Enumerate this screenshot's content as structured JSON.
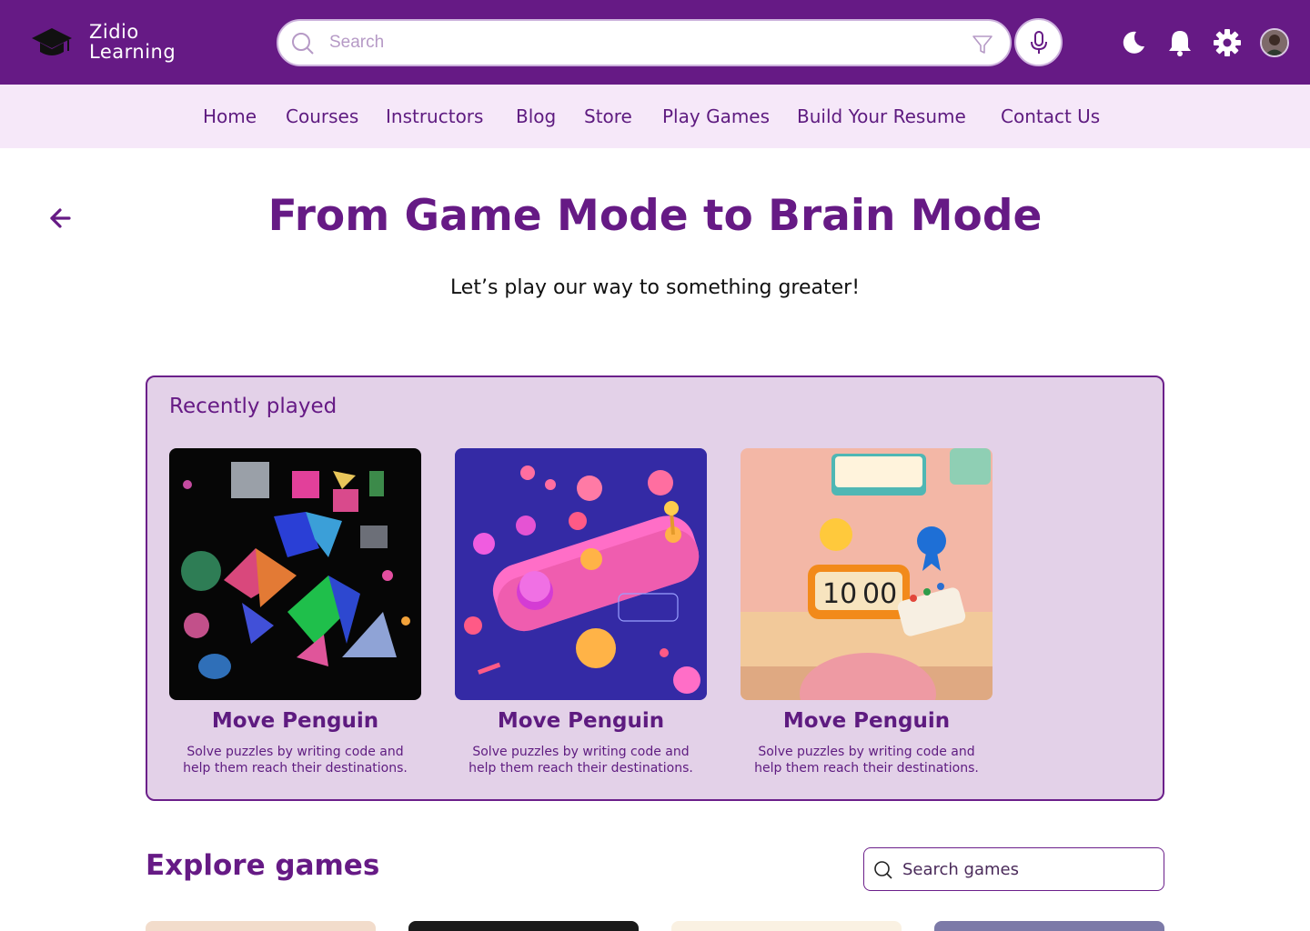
{
  "brand": {
    "line1": "Zidio",
    "line2": "Learning",
    "icon": "graduation-cap-icon"
  },
  "header": {
    "search_placeholder": "Search",
    "icons": [
      "search-icon",
      "filter-icon",
      "microphone-icon",
      "moon-icon",
      "bell-icon",
      "gear-icon",
      "avatar"
    ]
  },
  "nav": {
    "items": [
      {
        "label": "Home"
      },
      {
        "label": "Courses"
      },
      {
        "label": "Instructors"
      },
      {
        "label": "Blog"
      },
      {
        "label": "Store"
      },
      {
        "label": "Play Games"
      },
      {
        "label": "Build Your Resume"
      },
      {
        "label": "Contact Us"
      }
    ]
  },
  "hero": {
    "title": "From Game Mode to Brain Mode",
    "subtitle": "Let’s play our way to something greater!"
  },
  "recently_played": {
    "heading": "Recently played",
    "cards": [
      {
        "title": "Move Penguin",
        "desc1": "Solve puzzles by writing code and",
        "desc2": "help them reach their destinations.",
        "image": "colorful-shapes-on-black"
      },
      {
        "title": "Move Penguin",
        "desc1": "Solve puzzles by writing code and",
        "desc2": "help them reach their destinations.",
        "image": "pink-arcade-controller"
      },
      {
        "title": "Move Penguin",
        "desc1": "Solve puzzles by writing code and",
        "desc2": "help them reach their destinations.",
        "image": "desk-with-timer-and-keyboard"
      }
    ],
    "clock": {
      "hours": "10",
      "minutes": "00"
    }
  },
  "explore": {
    "heading": "Explore games",
    "search_placeholder": "Search games"
  },
  "colors": {
    "primary": "#661a85",
    "nav_bg": "#f6e8f9",
    "panel_bg": "#e3d1e8"
  }
}
